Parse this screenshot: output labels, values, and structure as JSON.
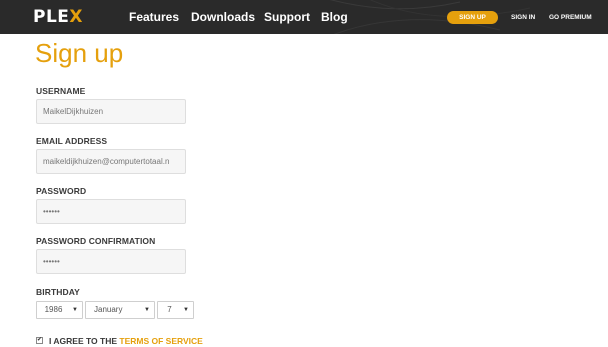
{
  "header": {
    "logo_main": "PLE",
    "logo_accent": "X",
    "nav": [
      "Features",
      "Downloads",
      "Support",
      "Blog"
    ],
    "signup_label": "SIGN UP",
    "signin_label": "SIGN IN",
    "premium_label": "GO PREMIUM"
  },
  "form": {
    "title": "Sign up",
    "username_label": "USERNAME",
    "username_value": "MaikelDijkhuizen",
    "email_label": "EMAIL ADDRESS",
    "email_value": "maikeldijkhuizen@computertotaal.n",
    "password_label": "PASSWORD",
    "password_value": "••••••",
    "password_confirm_label": "PASSWORD CONFIRMATION",
    "password_confirm_value": "••••••",
    "birthday_label": "BIRTHDAY",
    "birthday_year": "1986",
    "birthday_month": "January",
    "birthday_day": "7",
    "agree_text": "I AGREE TO THE ",
    "terms_link": "TERMS OF SERVICE",
    "agree_checked": "✔"
  },
  "colors": {
    "accent": "#e5a00d",
    "topbar": "#2a2a2a"
  }
}
